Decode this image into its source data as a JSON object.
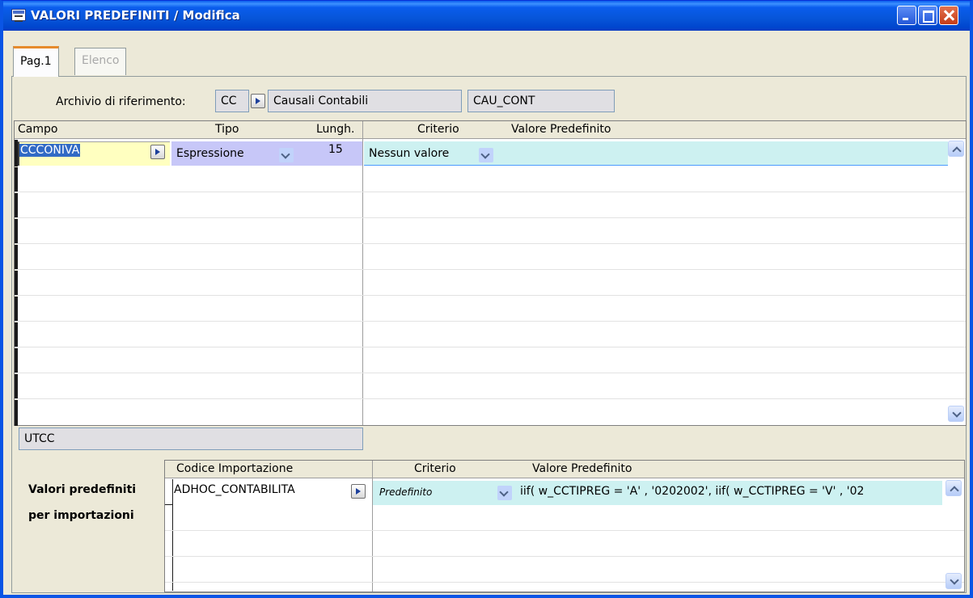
{
  "window": {
    "title": "VALORI PREDEFINITI / Modifica"
  },
  "tabs": [
    {
      "label": "Pag.1",
      "active": true
    },
    {
      "label": "Elenco",
      "active": false
    }
  ],
  "archivio": {
    "label": "Archivio di riferimento:",
    "code": "CC",
    "description": "Causali Contabili",
    "table": "CAU_CONT"
  },
  "main_grid": {
    "headers": {
      "campo": "Campo",
      "tipo": "Tipo",
      "lungh": "Lungh.",
      "criterio": "Criterio",
      "valore": "Valore Predefinito"
    },
    "rows": [
      {
        "campo": "CCCONIVA",
        "tipo": "Espressione",
        "lungh": "15",
        "criterio": "Nessun valore",
        "valore": ""
      }
    ]
  },
  "selected_field_name": "UTCC",
  "import_section": {
    "label_line1": "Valori predefiniti",
    "label_line2": "per importazioni",
    "headers": {
      "codice": "Codice Importazione",
      "criterio": "Criterio",
      "valore": "Valore Predefinito"
    },
    "rows": [
      {
        "codice": "ADHOC_CONTABILITA",
        "criterio": "Predefinito",
        "valore": "iif( w_CCTIPREG = 'A' , '0202002', iif( w_CCTIPREG = 'V' , '02"
      }
    ]
  },
  "colors": {
    "title_bar": "#0a5ded",
    "row_highlight": "#cdf1f1",
    "selected_text_bg": "#316ac5",
    "editing_cell": "#ffffc0"
  }
}
